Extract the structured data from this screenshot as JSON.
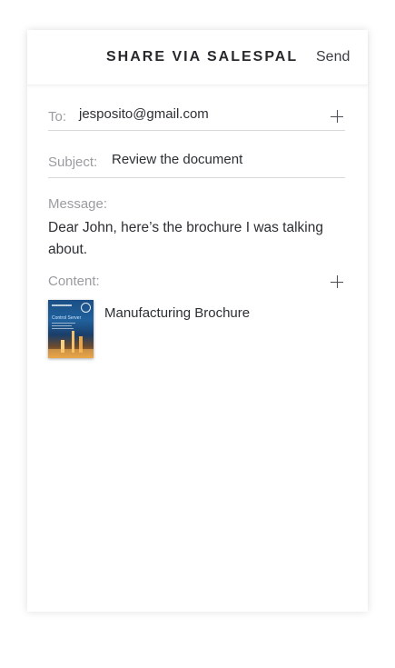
{
  "header": {
    "title": "SHARE VIA SALESPAL",
    "send_label": "Send"
  },
  "to": {
    "label": "To:",
    "value": "jesposito@gmail.com",
    "add_icon": "plus-icon"
  },
  "subject": {
    "label": "Subject:",
    "value": "Review the document"
  },
  "message": {
    "label": "Message:",
    "body": "Dear John, here’s the brochure I was talking about."
  },
  "content": {
    "label": "Content:",
    "add_icon": "plus-icon",
    "items": [
      {
        "title": "Manufacturing Brochure",
        "thumbnail_text": "Control Server"
      }
    ]
  },
  "colors": {
    "label_gray": "#9a9ca0",
    "text_dark": "#2c2f33",
    "divider": "#d9d9d9"
  }
}
